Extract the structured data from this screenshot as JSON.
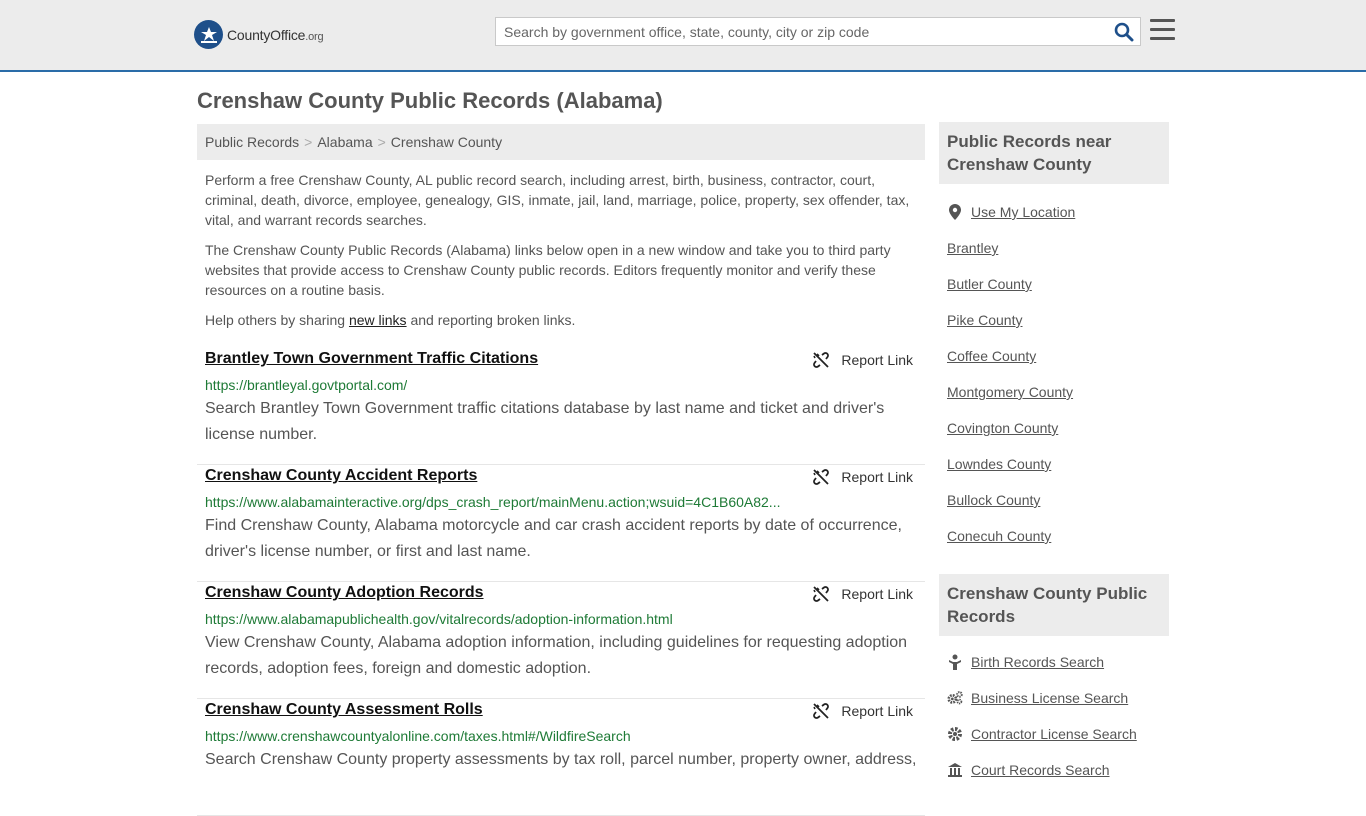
{
  "header": {
    "logo_text": "CountyOffice",
    "logo_org": ".org",
    "search_placeholder": "Search by government office, state, county, city or zip code"
  },
  "page_title": "Crenshaw County Public Records (Alabama)",
  "breadcrumb": [
    "Public Records",
    "Alabama",
    "Crenshaw County"
  ],
  "intro": {
    "p1": "Perform a free Crenshaw County, AL public record search, including arrest, birth, business, contractor, court, criminal, death, divorce, employee, genealogy, GIS, inmate, jail, land, marriage, police, property, sex offender, tax, vital, and warrant records searches.",
    "p2": "The Crenshaw County Public Records (Alabama) links below open in a new window and take you to third party websites that provide access to Crenshaw County public records. Editors frequently monitor and verify these resources on a routine basis.",
    "p3_before": "Help others by sharing ",
    "p3_link": "new links",
    "p3_after": " and reporting broken links."
  },
  "report_label": "Report Link",
  "records": [
    {
      "title": "Brantley Town Government Traffic Citations",
      "url": "https://brantleyal.govtportal.com/",
      "desc": "Search Brantley Town Government traffic citations database by last name and ticket and driver's license number."
    },
    {
      "title": "Crenshaw County Accident Reports",
      "url": "https://www.alabamainteractive.org/dps_crash_report/mainMenu.action;wsuid=4C1B60A82...",
      "desc": "Find Crenshaw County, Alabama motorcycle and car crash accident reports by date of occurrence, driver's license number, or first and last name."
    },
    {
      "title": "Crenshaw County Adoption Records",
      "url": "https://www.alabamapublichealth.gov/vitalrecords/adoption-information.html",
      "desc": "View Crenshaw County, Alabama adoption information, including guidelines for requesting adoption records, adoption fees, foreign and domestic adoption."
    },
    {
      "title": "Crenshaw County Assessment Rolls",
      "url": "https://www.crenshawcountyalonline.com/taxes.html#/WildfireSearch",
      "desc": "Search Crenshaw County property assessments by tax roll, parcel number, property owner, address,"
    }
  ],
  "sidebar": {
    "near_title": "Public Records near Crenshaw County",
    "use_location": "Use My Location",
    "near_items": [
      "Brantley",
      "Butler County",
      "Pike County",
      "Coffee County",
      "Montgomery County",
      "Covington County",
      "Lowndes County",
      "Bullock County",
      "Conecuh County"
    ],
    "records_title": "Crenshaw County Public Records",
    "record_items": [
      {
        "label": "Birth Records Search",
        "icon": "baby-icon"
      },
      {
        "label": "Business License Search",
        "icon": "gears-icon"
      },
      {
        "label": "Contractor License Search",
        "icon": "gear-icon"
      },
      {
        "label": "Court Records Search",
        "icon": "courthouse-icon"
      }
    ]
  },
  "colors": {
    "accent_blue": "#2a6ca8",
    "url_green": "#1e7a36",
    "header_bg": "#ececec"
  }
}
